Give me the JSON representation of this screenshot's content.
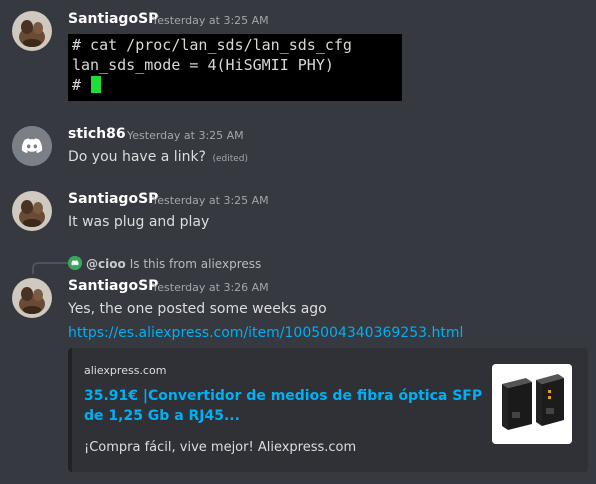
{
  "messages": [
    {
      "username": "SantiagoSP",
      "timestamp": "Yesterday at 3:25 AM",
      "terminal": {
        "line1": "# cat /proc/lan_sds/lan_sds_cfg",
        "line2": "lan_sds_mode = 4(HiSGMII PHY)",
        "line3": "#"
      }
    },
    {
      "username": "stich86",
      "timestamp": "Yesterday at 3:25 AM",
      "text": "Do you have a link?",
      "edited": "(edited)"
    },
    {
      "username": "SantiagoSP",
      "timestamp": "Yesterday at 3:25 AM",
      "text": "It was plug and play"
    },
    {
      "reply": {
        "user": "@cioo",
        "text": "Is this from aliexpress"
      },
      "username": "SantiagoSP",
      "timestamp": "Yesterday at 3:26 AM",
      "text": "Yes, the one posted some weeks ago",
      "link": "https://es.aliexpress.com/item/1005004340369253.html",
      "embed": {
        "provider": "aliexpress.com",
        "title": "35.91€ |Convertidor de medios de fibra óptica SFP de 1,25 Gb a RJ45...",
        "description": "¡Compra fácil, vive mejor! Aliexpress.com"
      }
    }
  ],
  "colors": {
    "background": "#36393f",
    "link": "#00aff4",
    "embed_bg": "#2f3136",
    "discord_blurple": "#5865f2",
    "cursor_green": "#1fdc3a"
  },
  "icons": {
    "default_avatar": "discord-logo-icon",
    "reply_avatar": "discord-logo-icon"
  }
}
